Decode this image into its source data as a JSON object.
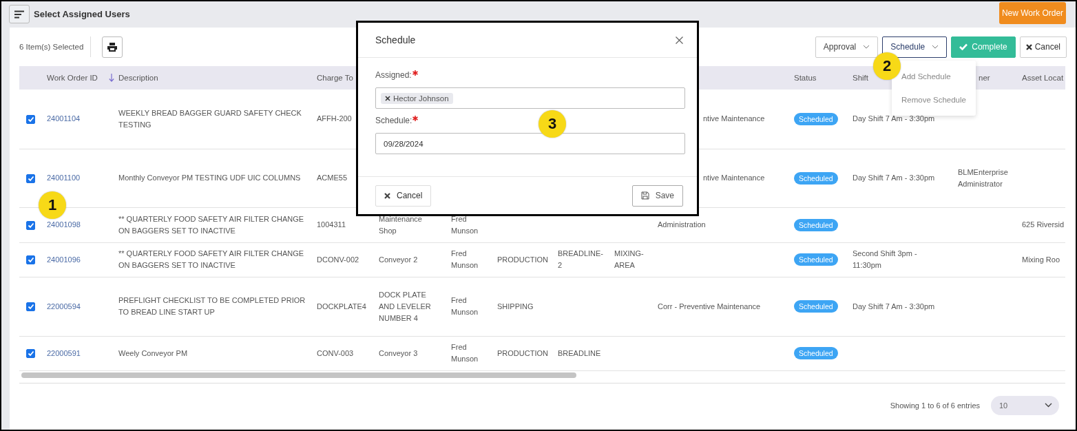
{
  "header": {
    "title": "Select Assigned Users",
    "new_button": "New Work Order"
  },
  "toolbar": {
    "selected_count": "6 Item(s) Selected",
    "actions": [
      {
        "label": "Approval",
        "kind": "dropdown",
        "selected": false
      },
      {
        "label": "Schedule",
        "kind": "dropdown",
        "selected": true
      },
      {
        "label": "Complete",
        "kind": "complete"
      },
      {
        "label": "Cancel",
        "kind": "cancel"
      }
    ]
  },
  "schedule_menu": {
    "items": [
      "Add Schedule",
      "Remove Schedule"
    ]
  },
  "table": {
    "columns": [
      {
        "header": "Work Order ID",
        "kind": "link"
      },
      {
        "header": "Description",
        "kind": "text",
        "sorted": true
      },
      {
        "header": "Charge To",
        "kind": "text"
      },
      {
        "kind": "text"
      },
      {
        "kind": "text"
      },
      {
        "kind": "text"
      },
      {
        "kind": "text"
      },
      {
        "kind": "text"
      },
      {
        "kind": "text"
      },
      {
        "header": "Status",
        "kind": "badge"
      },
      {
        "header": "Shift",
        "kind": "text"
      },
      {
        "header": "ner",
        "kind": "text"
      },
      {
        "header": "Asset Locat",
        "kind": "text"
      }
    ],
    "rows": [
      {
        "selected": true,
        "cells": [
          "24001104",
          "WEEKLY BREAD BAGGER GUARD SAFETY CHECK TESTING",
          "AFFH-200",
          null,
          null,
          null,
          null,
          null,
          "ntive Maintenance",
          "Scheduled",
          "Day Shift 7 Am - 3:30pm",
          null,
          null
        ]
      },
      {
        "selected": true,
        "cells": [
          "24001100",
          "Monthly Conveyor PM TESTING UDF UIC COLUMNS",
          "ACME55",
          null,
          null,
          null,
          null,
          null,
          "ntive Maintenance",
          "Scheduled",
          "Day Shift 7 Am - 3:30pm",
          "BLMEnterprise Administrator",
          null
        ]
      },
      {
        "selected": true,
        "cells": [
          "24001098",
          "** QUARTERLY FOOD SAFETY AIR FILTER CHANGE ON BAGGERS SET TO INACTIVE",
          "1004311",
          "Maintenance Shop",
          "Fred Munson",
          null,
          null,
          null,
          "Administration",
          "Scheduled",
          null,
          null,
          "625 Riversid"
        ]
      },
      {
        "selected": true,
        "cells": [
          "24001096",
          "** QUARTERLY FOOD SAFETY AIR FILTER CHANGE ON BAGGERS SET TO INACTIVE",
          "DCONV-002",
          "Conveyor 2",
          "Fred Munson",
          "PRODUCTION",
          "BREADLINE-2",
          "MIXING-AREA",
          null,
          "Scheduled",
          "Second Shift 3pm - 11:30pm",
          null,
          "Mixing Roo"
        ]
      },
      {
        "selected": true,
        "cells": [
          "22000594",
          "PREFLIGHT CHECKLIST TO BE COMPLETED PRIOR TO BREAD LINE START UP",
          "DOCKPLATE4",
          "DOCK PLATE AND LEVELER NUMBER 4",
          "Fred Munson",
          "SHIPPING",
          null,
          null,
          "Corr - Preventive Maintenance",
          "Scheduled",
          "Day Shift 7 Am - 3:30pm",
          null,
          null
        ]
      },
      {
        "selected": true,
        "cells": [
          "22000591",
          "Weely Conveyor PM",
          "CONV-003",
          "Conveyor 3",
          "Fred Munson",
          "PRODUCTION",
          "BREADLINE",
          null,
          null,
          "Scheduled",
          null,
          null,
          null
        ]
      }
    ]
  },
  "footer": {
    "info": "Showing 1 to 6 of 6 entries",
    "page_size": "10"
  },
  "dialog": {
    "title": "Schedule",
    "fields": [
      {
        "label": "Assigned:",
        "kind": "tags",
        "required": true,
        "tags": [
          "Hector Johnson"
        ]
      },
      {
        "label": "Schedule:",
        "kind": "date",
        "required": true,
        "value": "09/28/2024"
      }
    ],
    "cancel": "Cancel",
    "save": "Save"
  },
  "callouts": [
    "1",
    "2",
    "3"
  ]
}
